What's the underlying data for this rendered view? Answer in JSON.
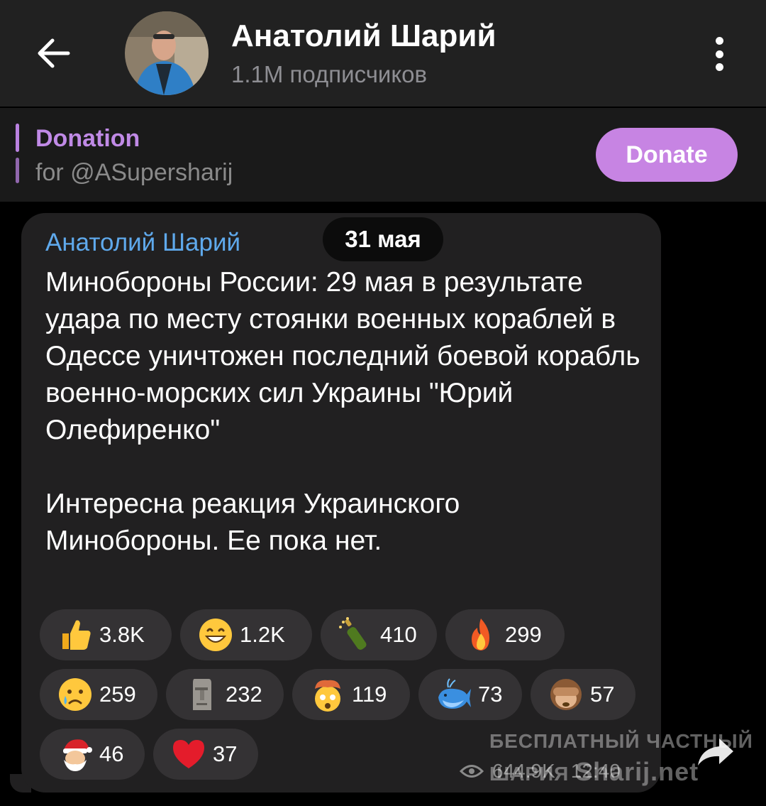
{
  "header": {
    "back_label": "back",
    "channel_name": "Анатолий Шарий",
    "subscribers": "1.1M подписчиков"
  },
  "pinned": {
    "title": "Donation",
    "subtitle": "for @ASupersharij",
    "button_label": "Donate"
  },
  "message": {
    "sender": "Анатолий Шарий",
    "date": "31 мая",
    "paragraph1": "Минобороны России: 29 мая в результате удара по месту стоянки военных кораблей в Одессе уничтожен последний боевой корабль военно-морских сил Украины \"Юрий Олефиренко\"",
    "paragraph2": "Интересна реакция Украинского Минобороны. Ее пока нет.",
    "views": "644.9K",
    "time": "12:40"
  },
  "reactions": [
    {
      "icon": "thumbs-up",
      "count": "3.8K"
    },
    {
      "icon": "grinning-face",
      "count": "1.2K"
    },
    {
      "icon": "champagne-bottle",
      "count": "410"
    },
    {
      "icon": "fire",
      "count": "299"
    },
    {
      "icon": "crying-face",
      "count": "259"
    },
    {
      "icon": "moai",
      "count": "232"
    },
    {
      "icon": "exploding-head",
      "count": "119"
    },
    {
      "icon": "whale",
      "count": "73"
    },
    {
      "icon": "see-no-evil-monkey",
      "count": "57"
    },
    {
      "icon": "santa-claus",
      "count": "46"
    },
    {
      "icon": "red-heart",
      "count": "37"
    }
  ],
  "watermark": {
    "line1": "БЕСПЛАТНЫЙ ЧАСТНЫЙ",
    "line2": "ШАРИЯ",
    "site": "Sharij.net"
  },
  "colors": {
    "header_bg": "#212121",
    "bubble_bg": "#212021",
    "sender": "#5fa9ec",
    "accent_purple": "#c784e3",
    "reaction_bg": "#343234"
  }
}
